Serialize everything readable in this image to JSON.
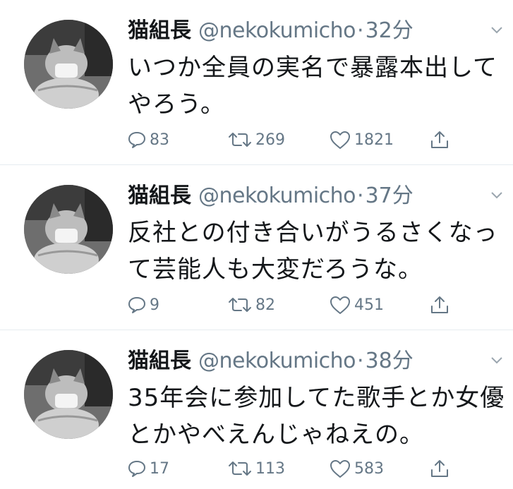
{
  "colors": {
    "text": "#14171a",
    "secondary": "#657786",
    "divider": "#e6ecf0"
  },
  "icons": {
    "reply": "speech-bubble-icon",
    "retweet": "retweet-icon",
    "like": "heart-icon",
    "share": "share-icon",
    "menu": "chevron-down-icon"
  },
  "tweets": [
    {
      "name": "猫組長",
      "handle": "@nekokumicho",
      "separator": "·",
      "time": "32分",
      "text": "いつか全員の実名で暴露本出してやろう。",
      "replies": "83",
      "retweets": "269",
      "likes": "1821"
    },
    {
      "name": "猫組長",
      "handle": "@nekokumicho",
      "separator": "·",
      "time": "37分",
      "text": "反社との付き合いがうるさくなって芸能人も大変だろうな。",
      "replies": "9",
      "retweets": "82",
      "likes": "451"
    },
    {
      "name": "猫組長",
      "handle": "@nekokumicho",
      "separator": "·",
      "time": "38分",
      "text": "35年会に参加してた歌手とか女優とかやべえんじゃねえの。",
      "replies": "17",
      "retweets": "113",
      "likes": "583"
    }
  ]
}
